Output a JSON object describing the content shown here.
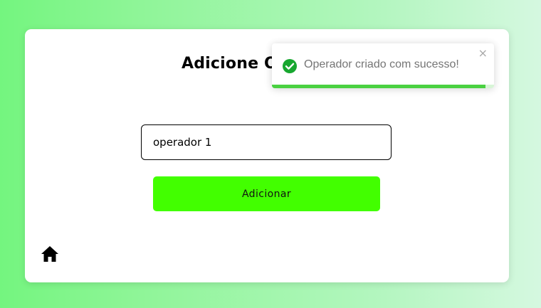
{
  "page": {
    "title": "Adicione Operador"
  },
  "form": {
    "operator_name_value": "operador 1",
    "submit_label": "Adicionar"
  },
  "nav": {
    "home_icon": "home-icon"
  },
  "toast": {
    "message": "Operador criado com sucesso!",
    "close_glyph": "×",
    "status_icon": "check-circle-icon",
    "progress_remaining": 0.96
  },
  "colors": {
    "accent_green": "#42ff00",
    "success_green": "#4ad141"
  }
}
